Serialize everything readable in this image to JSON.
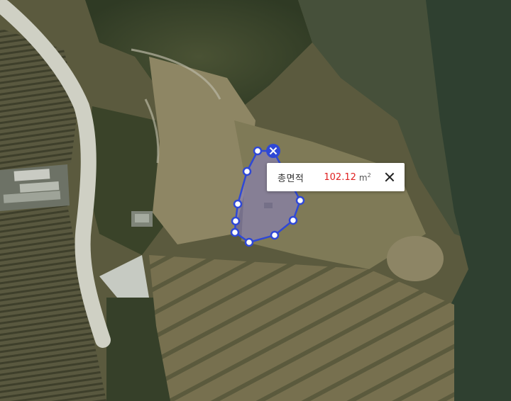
{
  "area_popup": {
    "label": "총면적",
    "value": "102.12",
    "unit": "m",
    "unit_power": "2",
    "close_icon": "close-icon"
  },
  "measurement": {
    "polygon_color": "#2f48d6",
    "fill_color": "#8c84c8",
    "vertex_count": 11,
    "delete_icon": "close-icon"
  },
  "colors": {
    "value_text": "#e02020",
    "road": "#cfd0c4",
    "vegetation": "#3f4a2e",
    "field": "#8c8463"
  }
}
